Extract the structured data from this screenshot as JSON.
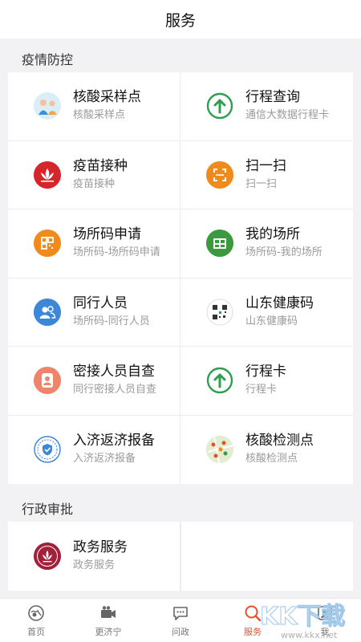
{
  "header": {
    "title": "服务"
  },
  "sections": [
    {
      "title": "疫情防控",
      "items": [
        {
          "title": "核酸采样点",
          "subtitle": "核酸采样点",
          "icon": "nucleic-sampling-icon"
        },
        {
          "title": "行程查询",
          "subtitle": "通信大数据行程卡",
          "icon": "itinerary-query-icon"
        },
        {
          "title": "疫苗接种",
          "subtitle": "疫苗接种",
          "icon": "vaccine-icon"
        },
        {
          "title": "扫一扫",
          "subtitle": "扫一扫",
          "icon": "scan-icon"
        },
        {
          "title": "场所码申请",
          "subtitle": "场所码-场所码申请",
          "icon": "venue-code-apply-icon"
        },
        {
          "title": "我的场所",
          "subtitle": "场所码-我的场所",
          "icon": "my-venue-icon"
        },
        {
          "title": "同行人员",
          "subtitle": "场所码-同行人员",
          "icon": "companions-icon"
        },
        {
          "title": "山东健康码",
          "subtitle": "山东健康码",
          "icon": "health-code-icon"
        },
        {
          "title": "密接人员自查",
          "subtitle": "同行密接人员自查",
          "icon": "close-contact-icon"
        },
        {
          "title": "行程卡",
          "subtitle": "行程卡",
          "icon": "itinerary-card-icon"
        },
        {
          "title": "入济返济报备",
          "subtitle": "入济返济报备",
          "icon": "jinan-report-icon"
        },
        {
          "title": "核酸检测点",
          "subtitle": "核酸检测点",
          "icon": "test-site-map-icon"
        }
      ]
    },
    {
      "title": "行政审批",
      "items": [
        {
          "title": "政务服务",
          "subtitle": "政务服务",
          "icon": "gov-service-icon"
        }
      ]
    }
  ],
  "tabbar": [
    {
      "label": "首页",
      "icon": "home-icon",
      "active": false
    },
    {
      "label": "更济宁",
      "icon": "video-icon",
      "active": false
    },
    {
      "label": "问政",
      "icon": "chat-icon",
      "active": false
    },
    {
      "label": "服务",
      "icon": "search-icon",
      "active": true
    },
    {
      "label": "我",
      "icon": "profile-icon",
      "active": false
    }
  ],
  "colors": {
    "accent": "#e8502a",
    "green": "#2e9e4f",
    "red": "#d7262b",
    "orange": "#f08a1c",
    "blue": "#3e86d8",
    "salmon": "#f0846b"
  },
  "watermark": {
    "text": "KK下载",
    "url": "www.kkx.net"
  }
}
